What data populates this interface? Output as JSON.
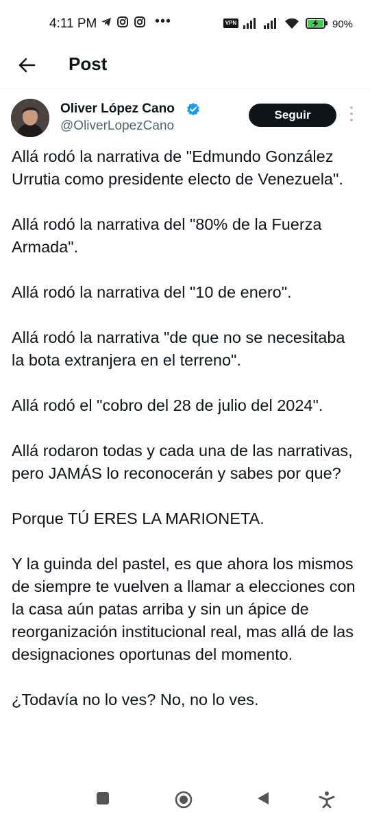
{
  "status_bar": {
    "time": "4:11 PM",
    "vpn_label": "VPN",
    "battery_percent": "90%",
    "icons": [
      "telegram-icon",
      "instagram-icon",
      "instagram-icon",
      "more-icon",
      "vpn-icon",
      "signal-icon",
      "signal-icon",
      "wifi-icon",
      "battery-charging-icon"
    ]
  },
  "header": {
    "title": "Post"
  },
  "author": {
    "name": "Oliver López Cano",
    "handle": "@OliverLopezCano",
    "verified": true
  },
  "follow_button": {
    "label": "Seguir"
  },
  "post": {
    "paragraphs": [
      "Allá rodó la narrativa de \"Edmundo González Urrutia como presidente electo de Venezuela\".",
      "Allá rodó la narrativa del \"80% de la Fuerza Armada\".",
      "Allá rodó la narrativa del \"10 de enero\".",
      "Allá rodó la narrativa \"de que no se necesitaba la bota extranjera en el terreno\".",
      "Allá rodó el \"cobro del 28 de julio del 2024\".",
      "Allá rodaron todas y cada una de las narrativas, pero JAMÁS lo reconocerán y sabes por que?",
      "Porque TÚ ERES LA MARIONETA.",
      "Y la guinda del pastel, es que ahora los mismos de siempre te vuelven a llamar a elecciones con la casa aún patas arriba y sin un ápice de reorganización institucional real, mas allá de las designaciones oportunas del momento.",
      "¿Todavía no lo ves? No, no lo ves."
    ]
  },
  "colors": {
    "text": "#0f1419",
    "secondary_text": "#536471",
    "verified_blue": "#1d9bf0",
    "follow_bg": "#0f1419",
    "battery_green": "#3ecf4c"
  }
}
